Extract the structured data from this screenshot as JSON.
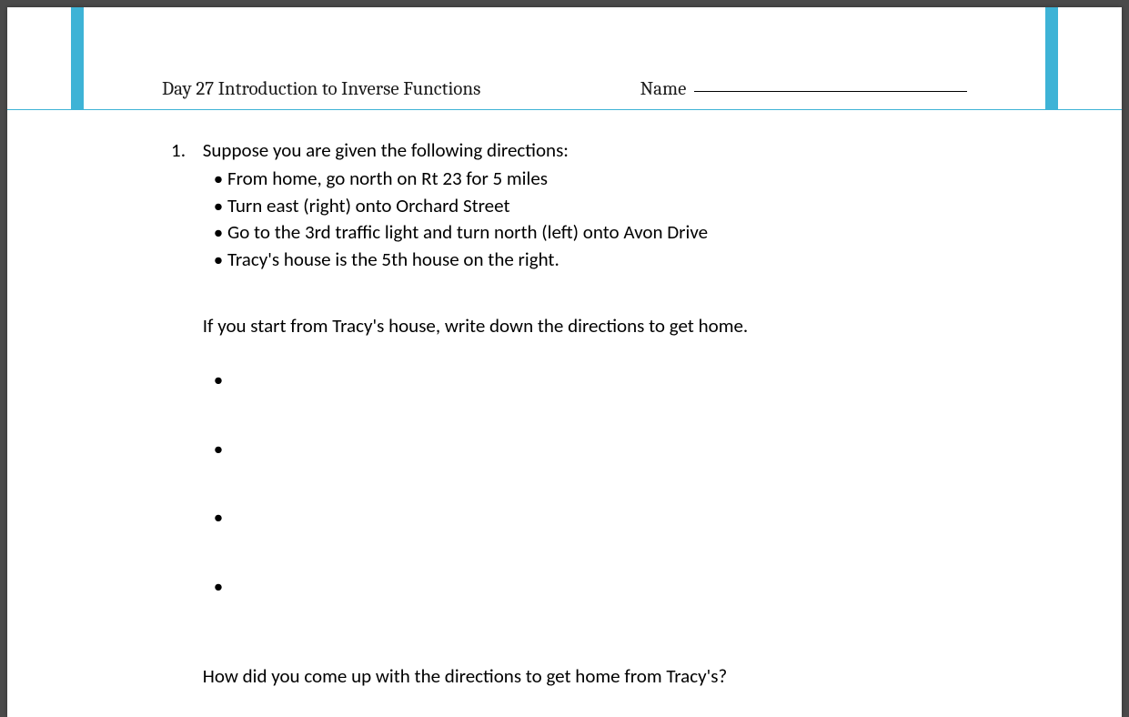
{
  "header": {
    "title": "Day 27 Introduction to Inverse Functions",
    "name_label": "Name"
  },
  "question": {
    "number": "1.",
    "prompt_intro": "Suppose you are given the following directions:",
    "bullets": [
      "From home, go north on Rt 23 for 5 miles",
      "Turn east (right) onto Orchard Street",
      "Go to the 3rd traffic light and turn north (left) onto Avon Drive",
      "Tracy's house is the 5th house on the right."
    ],
    "reverse_prompt": "If you start from Tracy's house, write down the directions to get home.",
    "blank_bullets": [
      "•",
      "•",
      "•",
      "•"
    ],
    "followup": "How did you come up with the directions to get home from Tracy's?"
  }
}
